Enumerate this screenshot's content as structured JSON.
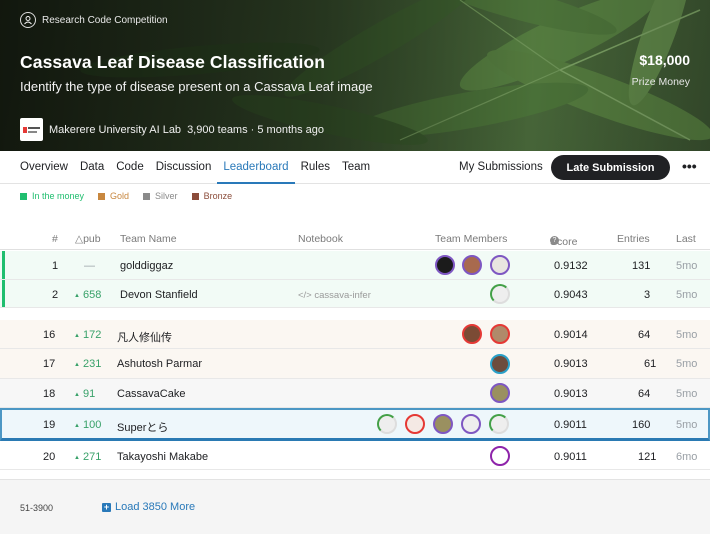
{
  "hero": {
    "type_label": "Research Code Competition",
    "title": "Cassava Leaf Disease Classification",
    "subtitle": "Identify the type of disease present on a Cassava Leaf image",
    "prize": "$18,000",
    "prize_label": "Prize Money",
    "host": "Makerere University AI Lab",
    "meta": "3,900 teams · 5 months ago"
  },
  "tabs": [
    "Overview",
    "Data",
    "Code",
    "Discussion",
    "Leaderboard",
    "Rules",
    "Team"
  ],
  "active_tab": "Leaderboard",
  "my_submissions": "My Submissions",
  "late_submission": "Late Submission",
  "more_label": "•••",
  "legend": {
    "money": "In the money",
    "gold": "Gold",
    "silver": "Silver",
    "bronze": "Bronze"
  },
  "legend_colors": {
    "money": "#20be6f",
    "gold": "#c8873f",
    "silver": "#8a8a8a",
    "bronze": "#8b4c3a"
  },
  "columns": {
    "rank": "#",
    "delta": "△pub",
    "team": "Team Name",
    "notebook": "Notebook",
    "members": "Team Members",
    "score": "Score",
    "entries": "Entries",
    "last": "Last"
  },
  "rows": [
    {
      "rank": "1",
      "delta": "—",
      "team": "golddiggaz",
      "notebook": "",
      "score": "0.9132",
      "entries": "131",
      "last": "5mo"
    },
    {
      "rank": "2",
      "delta": "658",
      "team": "Devon Stanfield",
      "notebook": "</> cassava-infer",
      "score": "0.9043",
      "entries": "3",
      "last": "5mo"
    },
    {
      "rank": "16",
      "delta": "172",
      "team": "凡人修仙传",
      "notebook": "",
      "score": "0.9014",
      "entries": "64",
      "last": "5mo"
    },
    {
      "rank": "17",
      "delta": "231",
      "team": "Ashutosh Parmar",
      "notebook": "",
      "score": "0.9013",
      "entries": "61",
      "last": "5mo"
    },
    {
      "rank": "18",
      "delta": "91",
      "team": "CassavaCake",
      "notebook": "",
      "score": "0.9013",
      "entries": "64",
      "last": "5mo"
    },
    {
      "rank": "19",
      "delta": "100",
      "team": "Superとら",
      "notebook": "",
      "score": "0.9011",
      "entries": "160",
      "last": "5mo"
    },
    {
      "rank": "20",
      "delta": "271",
      "team": "Takayoshi Makabe",
      "notebook": "",
      "score": "0.9011",
      "entries": "121",
      "last": "6mo"
    }
  ],
  "footer": {
    "range": "51-3900",
    "load_more": "Load 3850 More"
  }
}
